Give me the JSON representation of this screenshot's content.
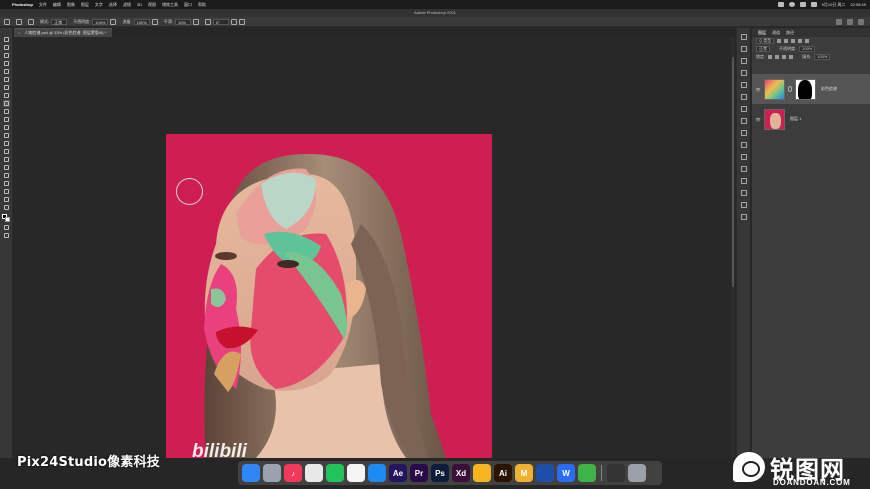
{
  "menubar": {
    "items": [
      "Photoshop",
      "文件",
      "编辑",
      "图像",
      "图层",
      "文字",
      "选择",
      "滤镜",
      "3D",
      "视图",
      "增效工具",
      "窗口",
      "帮助"
    ],
    "clock": "22:08:49",
    "date": "5月10日 周二"
  },
  "window": {
    "title": "Adobe Photoshop 2021"
  },
  "options_bar": {
    "mode_label": "模式:",
    "mode_value": "正常",
    "opacity_label": "不透明度:",
    "opacity_value": "100%",
    "flow_label": "流量:",
    "flow_value": "100%",
    "smooth_label": "平滑:",
    "smooth_value": "10%",
    "angle_value": "0°"
  },
  "document_tab": {
    "label": "人物脸谱.psd @ 33% (彩色脸谱, 图层蒙版/8) *",
    "close": "×"
  },
  "layers_panel": {
    "tabs": [
      "图层",
      "通道",
      "路径"
    ],
    "active_tab": "图层",
    "kind_filter": "Q 类型",
    "blend_mode": "正常",
    "opacity_label": "不透明度:",
    "opacity_value": "100%",
    "lock_label": "锁定:",
    "fill_label": "填充:",
    "fill_value": "100%",
    "layers": [
      {
        "name": "彩色脸谱",
        "visible": true,
        "selected": true,
        "has_mask": true
      },
      {
        "name": "图层 1",
        "visible": true,
        "selected": false,
        "has_mask": false
      }
    ]
  },
  "dock": {
    "apps": [
      {
        "name": "finder",
        "label": "",
        "color": "#2f86f6"
      },
      {
        "name": "launchpad",
        "label": "",
        "color": "#9aa3ad"
      },
      {
        "name": "music",
        "label": "♪",
        "color": "#f3395b"
      },
      {
        "name": "chrome",
        "label": "",
        "color": "#e8e8e8"
      },
      {
        "name": "wechat",
        "label": "",
        "color": "#22c35b"
      },
      {
        "name": "qq",
        "label": "",
        "color": "#f5f5f5"
      },
      {
        "name": "safari",
        "label": "",
        "color": "#1d8bf1"
      },
      {
        "name": "after-effects",
        "label": "Ae",
        "color": "#24155e"
      },
      {
        "name": "premiere",
        "label": "Pr",
        "color": "#2a0b4a"
      },
      {
        "name": "photoshop",
        "label": "Ps",
        "color": "#0b1d3a"
      },
      {
        "name": "xd",
        "label": "Xd",
        "color": "#3c0f3a"
      },
      {
        "name": "sketch",
        "label": "",
        "color": "#f6b41e"
      },
      {
        "name": "illustrator",
        "label": "Ai",
        "color": "#2a1400"
      },
      {
        "name": "mweb",
        "label": "M",
        "color": "#efb12f"
      },
      {
        "name": "c4d",
        "label": "",
        "color": "#1f4ea8"
      },
      {
        "name": "wps",
        "label": "W",
        "color": "#2a6df4"
      },
      {
        "name": "camtasia",
        "label": "",
        "color": "#3fb348"
      },
      {
        "name": "activity",
        "label": "",
        "color": "#333333"
      },
      {
        "name": "trash",
        "label": "",
        "color": "#9aa0a6"
      }
    ]
  },
  "watermark": {
    "studio": "Pix24Studio像素科技",
    "bilibili": "bilibili",
    "site_cn": "锐图网",
    "site_en": "DOANDOAN.COM"
  },
  "colors": {
    "photo_bg": "#cf1f52",
    "ps_panel": "#3c3c3c",
    "canvas_bg": "#282828"
  }
}
